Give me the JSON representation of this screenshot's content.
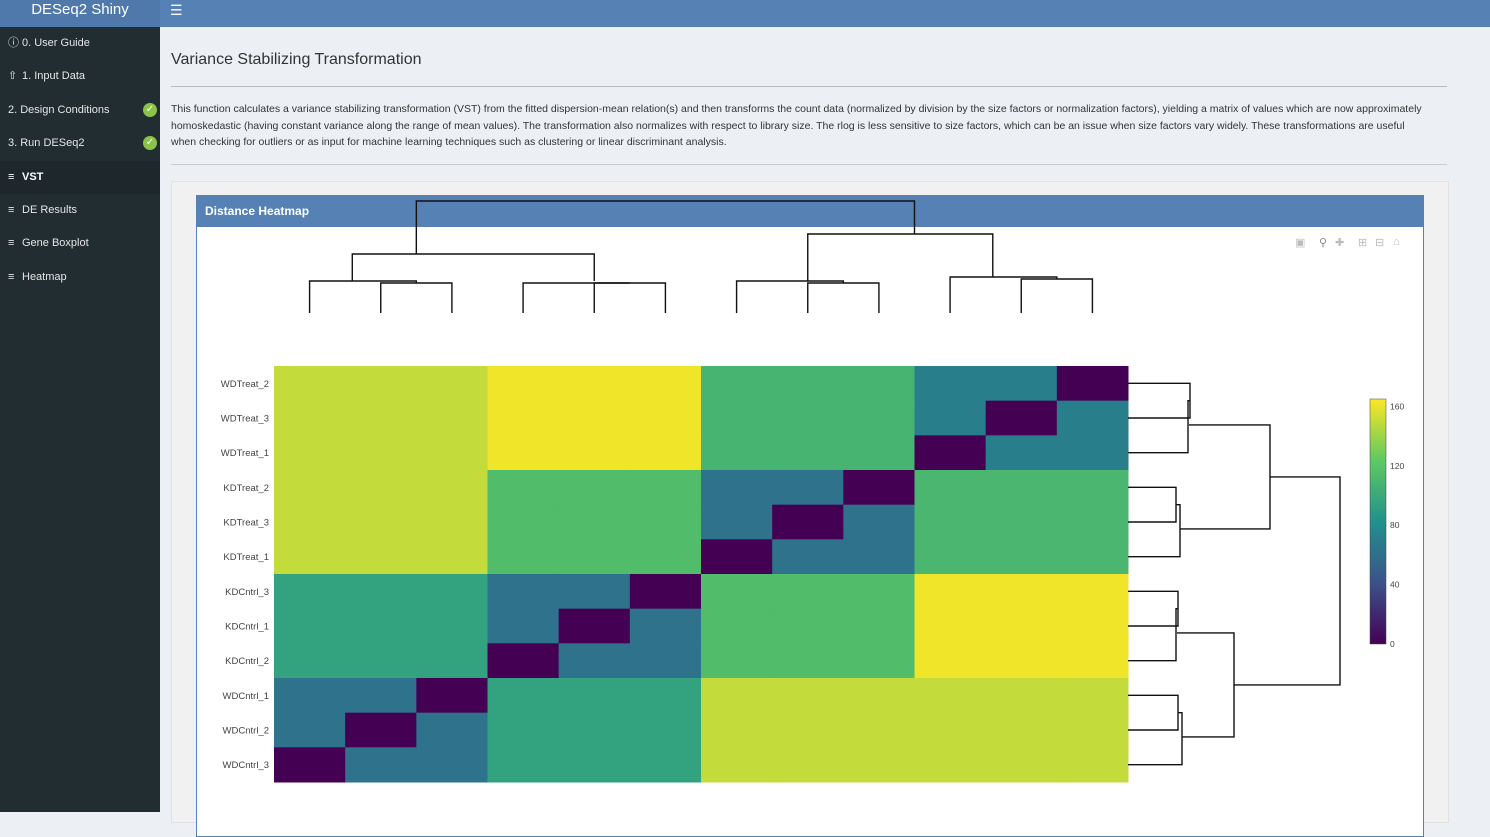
{
  "app": {
    "brand": "DESeq2 Shiny",
    "menu_icon": "hamburger-icon"
  },
  "sidebar": {
    "items": [
      {
        "label": "0. User Guide",
        "icon": "info-icon",
        "checked": false,
        "active": false
      },
      {
        "label": "1. Input Data",
        "icon": "upload-icon",
        "checked": false,
        "active": false
      },
      {
        "label": "2. Design Conditions",
        "icon": "",
        "checked": true,
        "active": false
      },
      {
        "label": "3. Run DESeq2",
        "icon": "",
        "checked": true,
        "active": false
      },
      {
        "label": "VST",
        "icon": "chart-icon",
        "checked": false,
        "active": true
      },
      {
        "label": "DE Results",
        "icon": "chart-icon",
        "checked": false,
        "active": false
      },
      {
        "label": "Gene Boxplot",
        "icon": "chart-icon",
        "checked": false,
        "active": false
      },
      {
        "label": "Heatmap",
        "icon": "chart-icon",
        "checked": false,
        "active": false
      }
    ]
  },
  "main": {
    "title": "Variance Stabilizing Transformation",
    "description": "This function calculates a variance stabilizing transformation (VST) from the fitted dispersion-mean relation(s) and then transforms the count data (normalized by division by the size factors or normalization factors), yielding a matrix of values which are now approximately homoskedastic (having constant variance along the range of mean values). The transformation also normalizes with respect to library size. The rlog is less sensitive to size factors, which can be an issue when size factors vary widely. These transformations are useful when checking for outliers or as input for machine learning techniques such as clustering or linear discriminant analysis.",
    "box_title": "Distance Heatmap",
    "modebar": [
      "camera-icon",
      "zoom-icon",
      "pan-icon",
      "zoom-in-icon",
      "zoom-out-icon",
      "home-icon"
    ]
  },
  "chart_data": {
    "type": "heatmap",
    "title": "",
    "row_labels": [
      "WDTreat_2",
      "WDTreat_3",
      "WDTreat_1",
      "KDTreat_2",
      "KDTreat_3",
      "KDTreat_1",
      "KDCntrl_3",
      "KDCntrl_1",
      "KDCntrl_2",
      "WDCntrl_1",
      "WDCntrl_2",
      "WDCntrl_3"
    ],
    "values": [
      [
        150,
        150,
        150,
        162,
        162,
        162,
        108,
        108,
        108,
        70,
        70,
        0
      ],
      [
        150,
        150,
        150,
        162,
        162,
        162,
        108,
        108,
        108,
        70,
        0,
        70
      ],
      [
        150,
        150,
        150,
        162,
        162,
        162,
        108,
        108,
        108,
        0,
        70,
        70
      ],
      [
        150,
        150,
        150,
        115,
        115,
        115,
        62,
        62,
        0,
        110,
        110,
        110
      ],
      [
        150,
        150,
        150,
        115,
        115,
        115,
        62,
        0,
        62,
        110,
        110,
        110
      ],
      [
        150,
        150,
        150,
        115,
        115,
        115,
        0,
        62,
        62,
        110,
        110,
        110
      ],
      [
        95,
        95,
        95,
        62,
        62,
        0,
        115,
        115,
        115,
        162,
        162,
        162
      ],
      [
        95,
        95,
        95,
        62,
        0,
        62,
        115,
        115,
        115,
        162,
        162,
        162
      ],
      [
        95,
        95,
        95,
        0,
        62,
        62,
        115,
        115,
        115,
        162,
        162,
        162
      ],
      [
        62,
        62,
        0,
        95,
        95,
        95,
        150,
        150,
        150,
        150,
        150,
        150
      ],
      [
        62,
        0,
        62,
        95,
        95,
        95,
        150,
        150,
        150,
        150,
        150,
        150
      ],
      [
        0,
        62,
        62,
        95,
        95,
        95,
        150,
        150,
        150,
        150,
        150,
        150
      ]
    ],
    "colorscale": "viridis",
    "zlim": [
      0,
      165
    ],
    "colorbar_ticks": [
      "160",
      "120",
      "80",
      "40",
      "0"
    ],
    "dendrogram": true
  }
}
